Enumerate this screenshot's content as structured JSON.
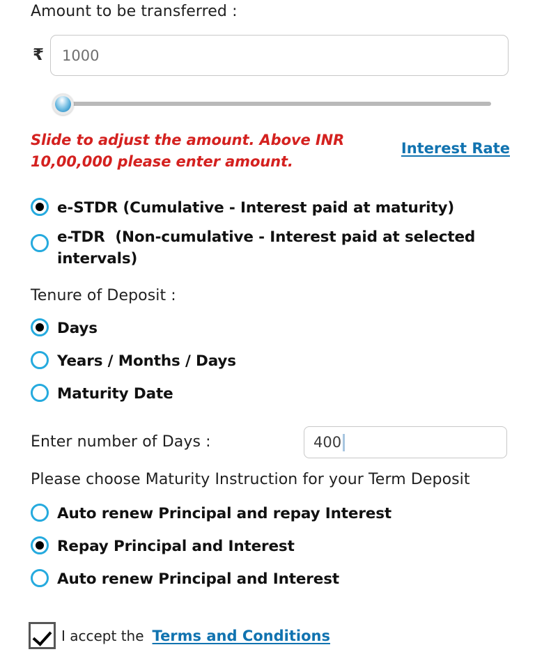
{
  "amount_section": {
    "title": "Amount to be transferred :",
    "currency_symbol": "₹",
    "amount_value": "1000",
    "amount_placeholder": "1000",
    "slider": {
      "value": "1000",
      "min": "1000",
      "max": "1000000",
      "position_percent": 0
    },
    "warning_text": "Slide to adjust the amount. Above INR 10,00,000 please enter amount.",
    "interest_rate_link": "Interest Rate"
  },
  "deposit_type": {
    "options": [
      {
        "label": "e-STDR (Cumulative - Interest paid at maturity)",
        "selected": true
      },
      {
        "label": "e-TDR  (Non-cumulative - Interest paid at selected intervals)",
        "selected": false
      }
    ]
  },
  "tenure": {
    "title": "Tenure of Deposit :",
    "options": [
      {
        "label": "Days",
        "selected": true
      },
      {
        "label": "Years / Months / Days",
        "selected": false
      },
      {
        "label": "Maturity Date",
        "selected": false
      }
    ]
  },
  "days_field": {
    "label": "Enter number of Days :",
    "value": "400"
  },
  "maturity_instruction": {
    "title": "Please choose Maturity Instruction for your Term Deposit",
    "options": [
      {
        "label": "Auto renew Principal and repay Interest",
        "selected": false
      },
      {
        "label": "Repay Principal and Interest",
        "selected": true
      },
      {
        "label": "Auto renew Principal and Interest",
        "selected": false
      }
    ]
  },
  "terms": {
    "checkbox_checked": true,
    "accept_text": "I accept the",
    "link_text": "Terms and Conditions"
  },
  "colors": {
    "radio_ring": "#25aade",
    "link_blue": "#1173b0",
    "warning_red": "#d4211f",
    "input_border": "#c8c8c8",
    "slider_track": "#b9b9b9",
    "checkbox_border": "#575757"
  }
}
